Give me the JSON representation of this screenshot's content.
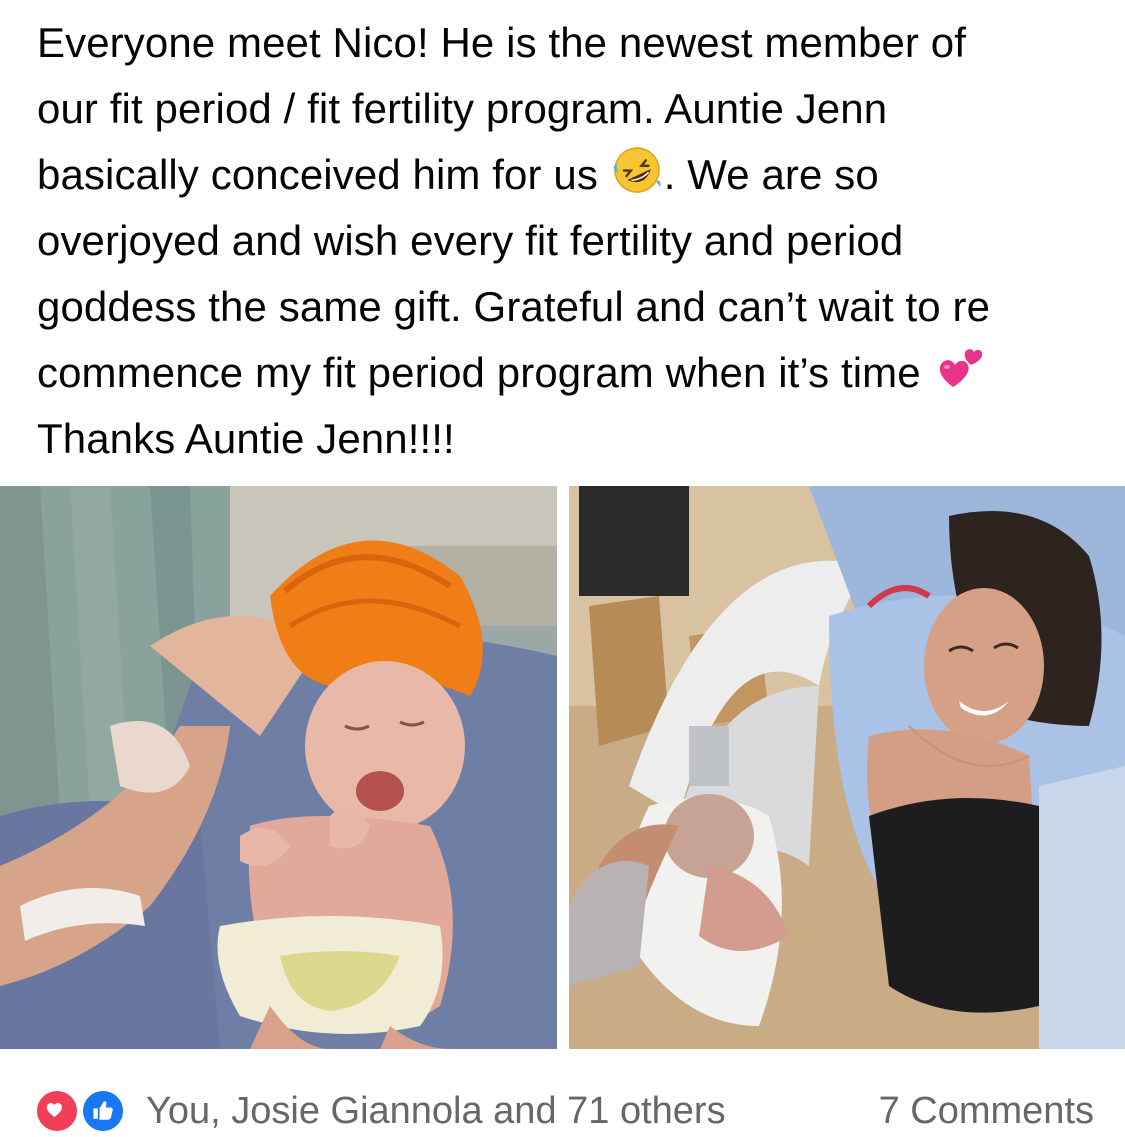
{
  "post": {
    "lines": [
      "Everyone meet Nico! He is the newest member of",
      "our fit period / fit fertility program. Auntie Jenn",
      "basically conceived him for us",
      ". We are so",
      "overjoyed and wish every fit fertility and period",
      "goddess the same gift. Grateful and can’t wait to re",
      "commence my fit period program when it’s time",
      "Thanks Auntie Jenn!!!!"
    ],
    "emojis": [
      "rolling-on-floor-laughing-emoji",
      "two-hearts-emoji"
    ]
  },
  "photos": {
    "left": {
      "icon": "newborn-in-orange-hat-photo"
    },
    "right": {
      "icon": "mother-holding-newborn-photo"
    }
  },
  "footer": {
    "reaction_icons": [
      "love-reaction-icon",
      "like-reaction-icon"
    ],
    "reactions_text": "You, Josie Giannola and 71 others",
    "comments_text": "7 Comments"
  },
  "colors": {
    "text": "#050505",
    "secondary_text": "#65676b",
    "love": "#f33e58",
    "like": "#1877f2"
  }
}
